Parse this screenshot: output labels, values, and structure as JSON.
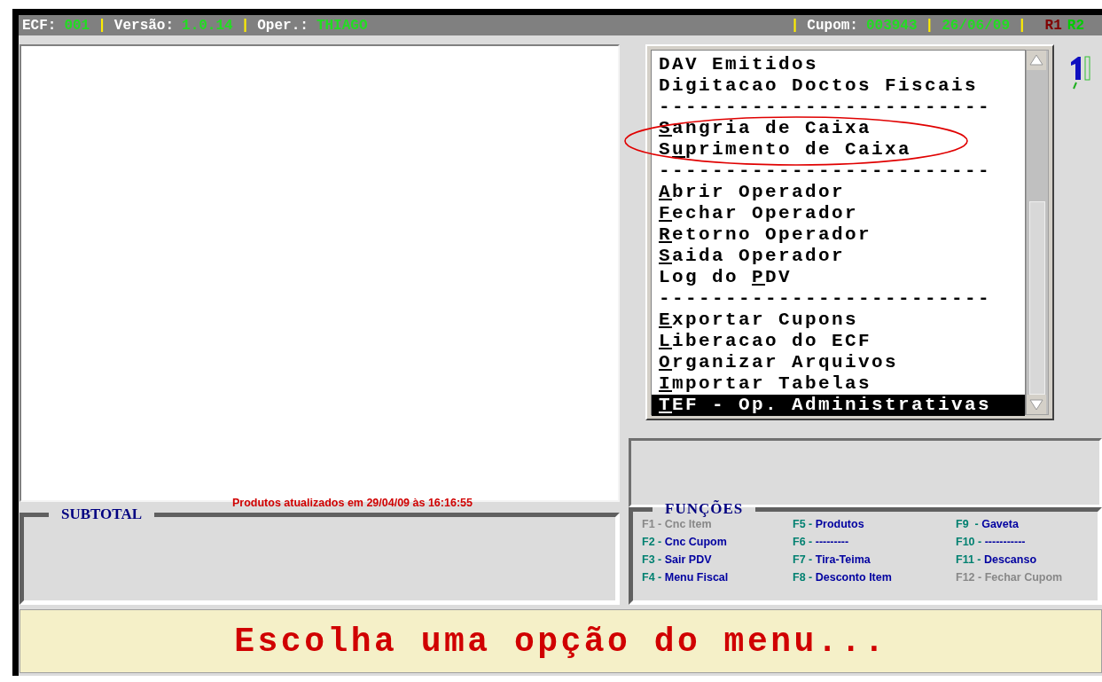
{
  "header": {
    "segments": [
      {
        "kind": "label",
        "text": "ECF:"
      },
      {
        "kind": "value",
        "text": "001"
      },
      {
        "kind": "divider",
        "text": "|"
      },
      {
        "kind": "label",
        "text": "Versão:"
      },
      {
        "kind": "value",
        "text": "1.0.14"
      },
      {
        "kind": "divider",
        "text": "|"
      },
      {
        "kind": "label",
        "text": "Oper.:"
      },
      {
        "kind": "value",
        "text": "THIAGO"
      },
      {
        "kind": "gap"
      },
      {
        "kind": "divider",
        "text": "|"
      },
      {
        "kind": "label",
        "text": "Cupom:"
      },
      {
        "kind": "value",
        "text": "003943"
      },
      {
        "kind": "divider",
        "text": "|"
      },
      {
        "kind": "value",
        "text": "26/06/09"
      },
      {
        "kind": "divider",
        "text": "|"
      }
    ],
    "indicators": [
      {
        "text": "R1",
        "color": "#800000"
      },
      {
        "text": "R2",
        "color": "#00cc00"
      }
    ]
  },
  "menu": {
    "items": [
      {
        "kind": "item",
        "before": "DAV Emitidos",
        "selected": false
      },
      {
        "kind": "item",
        "before": "Digitacao Doctos Fiscais",
        "selected": false
      },
      {
        "kind": "separator",
        "text": "-------------------------"
      },
      {
        "kind": "item",
        "accel": "S",
        "after": "angria de Caixa",
        "selected": false
      },
      {
        "kind": "item",
        "before": "S",
        "accel": "u",
        "after": "primento de Caixa",
        "selected": false
      },
      {
        "kind": "separator",
        "text": "-------------------------"
      },
      {
        "kind": "item",
        "accel": "A",
        "after": "brir Operador",
        "selected": false
      },
      {
        "kind": "item",
        "accel": "F",
        "after": "echar Operador",
        "selected": false
      },
      {
        "kind": "item",
        "accel": "R",
        "after": "etorno Operador",
        "selected": false
      },
      {
        "kind": "item",
        "accel": "S",
        "after": "aida Operador",
        "selected": false
      },
      {
        "kind": "item",
        "before": "Log do ",
        "accel": "P",
        "after": "DV",
        "selected": false
      },
      {
        "kind": "separator",
        "text": "-------------------------"
      },
      {
        "kind": "item",
        "accel": "E",
        "after": "xportar Cupons",
        "selected": false
      },
      {
        "kind": "item",
        "accel": "L",
        "after": "iberacao do ECF",
        "selected": false
      },
      {
        "kind": "item",
        "accel": "O",
        "after": "rganizar Arquivos",
        "selected": false
      },
      {
        "kind": "item",
        "accel": "I",
        "after": "mportar Tabelas",
        "selected": false
      },
      {
        "kind": "item",
        "accel": "T",
        "after": "EF - Op. Administrativas",
        "selected": true
      }
    ]
  },
  "subtotal": {
    "title": "SUBTOTAL",
    "notice": "Produtos atualizados em 29/04/09 às 16:16:55"
  },
  "functions": {
    "title": "FUNÇÕES",
    "keys": [
      {
        "key": "F1 -",
        "label": "Cnc Item",
        "disabled": true
      },
      {
        "key": "F2 -",
        "label": "Cnc Cupom",
        "disabled": false
      },
      {
        "key": "F3 -",
        "label": "Sair PDV",
        "disabled": false
      },
      {
        "key": "F4 -",
        "label": "Menu Fiscal",
        "disabled": false
      },
      {
        "key": "F5 -",
        "label": "Produtos",
        "disabled": false
      },
      {
        "key": "F6 -",
        "label": "---------",
        "disabled": false
      },
      {
        "key": "F7 -",
        "label": "Tira-Teima",
        "disabled": false
      },
      {
        "key": "F8 -",
        "label": "Desconto Item",
        "disabled": false
      },
      {
        "key": "F9  -",
        "label": "Gaveta",
        "disabled": false
      },
      {
        "key": "F10 -",
        "label": "-----------",
        "disabled": false
      },
      {
        "key": "F11 -",
        "label": "Descanso",
        "disabled": false
      },
      {
        "key": "F12 -",
        "label": "Fechar Cupom",
        "disabled": true
      }
    ]
  },
  "message": "Escolha uma opção do menu..."
}
